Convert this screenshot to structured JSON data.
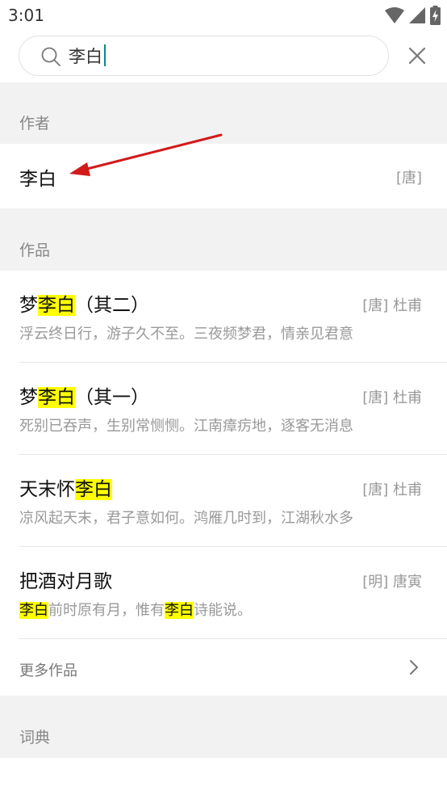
{
  "status_bar": {
    "time": "3:01",
    "icons": [
      "wifi-icon",
      "cell-signal-icon",
      "battery-charging-icon"
    ]
  },
  "search": {
    "value": "李白",
    "icon": "search-icon",
    "clear_icon": "close-icon"
  },
  "sections": {
    "authors": {
      "title": "作者",
      "items": [
        {
          "name": "李白",
          "dynasty": "[唐]"
        }
      ]
    },
    "works": {
      "title": "作品",
      "items": [
        {
          "title_parts": [
            {
              "text": "梦",
              "highlight": false
            },
            {
              "text": "李白",
              "highlight": true
            },
            {
              "text": "（其二）",
              "highlight": false
            }
          ],
          "meta": "[唐] 杜甫",
          "snippet_parts": [
            {
              "text": "浮云终日行，游子久不至。三夜频梦君，情亲见君意",
              "highlight": false
            }
          ]
        },
        {
          "title_parts": [
            {
              "text": "梦",
              "highlight": false
            },
            {
              "text": "李白",
              "highlight": true
            },
            {
              "text": "（其一）",
              "highlight": false
            }
          ],
          "meta": "[唐] 杜甫",
          "snippet_parts": [
            {
              "text": "死别已吞声，生别常恻恻。江南瘴疠地，逐客无消息",
              "highlight": false
            }
          ]
        },
        {
          "title_parts": [
            {
              "text": "天末怀",
              "highlight": false
            },
            {
              "text": "李白",
              "highlight": true
            }
          ],
          "meta": "[唐] 杜甫",
          "snippet_parts": [
            {
              "text": "凉风起天末，君子意如何。鸿雁几时到，江湖秋水多",
              "highlight": false
            }
          ]
        },
        {
          "title_parts": [
            {
              "text": "把酒对月歌",
              "highlight": false
            }
          ],
          "meta": "[明] 唐寅",
          "snippet_parts": [
            {
              "text": "李白",
              "highlight": true
            },
            {
              "text": "前时原有月，惟有",
              "highlight": false
            },
            {
              "text": "李白",
              "highlight": true
            },
            {
              "text": "诗能说。",
              "highlight": false
            }
          ]
        }
      ],
      "more_label": "更多作品",
      "more_icon": "chevron-right-icon"
    },
    "dictionary": {
      "title": "词典"
    }
  },
  "colors": {
    "highlight": "#ffff00",
    "caret": "#0a8a86",
    "annotation_arrow": "#d11a1a"
  },
  "annotation": {
    "icon": "red-arrow-icon"
  }
}
